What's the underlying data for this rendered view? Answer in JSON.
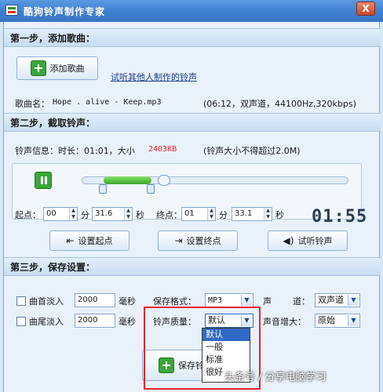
{
  "window": {
    "title": "酷狗铃声制作专家",
    "close_label": "X"
  },
  "step1": {
    "heading": "第一步，添加歌曲：",
    "add_song_label": "添加歌曲",
    "listen_others_link": "试听其他人制作的铃声",
    "song_name_label": "歌曲名：",
    "song_name": "Hope . alive - Keep.mp3",
    "song_info": "(06:12，双声道，44100Hz,320kbps)"
  },
  "step2": {
    "heading": "第二步，截取铃声：",
    "ringtone_info_label": "铃声信息：时长：01:01，大小",
    "ringtone_size": "2403KB",
    "size_note": "(铃声大小不得超过2.0M)",
    "start_label": "起点：",
    "start_min": "00",
    "start_sec": "31.6",
    "end_label": "终点：",
    "end_min": "01",
    "end_sec": "33.1",
    "min_unit": "分",
    "sec_unit": "秒",
    "clock": "01:55",
    "set_start_label": "设置起点",
    "set_end_label": "设置终点",
    "preview_label": "试听铃声",
    "selection_start": 0.08,
    "selection_end": 0.26,
    "playhead": 0.31
  },
  "step3": {
    "heading": "第三步，保存设置：",
    "fade_in_label": "曲首淡入",
    "fade_in_ms": "2000",
    "fade_out_label": "曲尾淡入",
    "fade_out_ms": "2000",
    "ms_unit": "毫秒",
    "format_label": "保存格式：",
    "format_value": "MP3",
    "channel_label_a": "声",
    "channel_label_b": "道：",
    "channel_value": "双声道",
    "quality_label": "铃声质量：",
    "quality_value": "默认",
    "quality_options": [
      "默认",
      "一般",
      "标准",
      "很好"
    ],
    "boost_label": "声音增大：",
    "boost_value": "原始",
    "save_label": "保存铃"
  },
  "watermark": "头条号 / 分享电脑学习",
  "colors": {
    "title_bar": "#3f7fcf",
    "accent_green": "#3aa63a",
    "size_red": "#e4262c",
    "highlight_box": "#e4262c",
    "selected_item": "#3169c6"
  }
}
